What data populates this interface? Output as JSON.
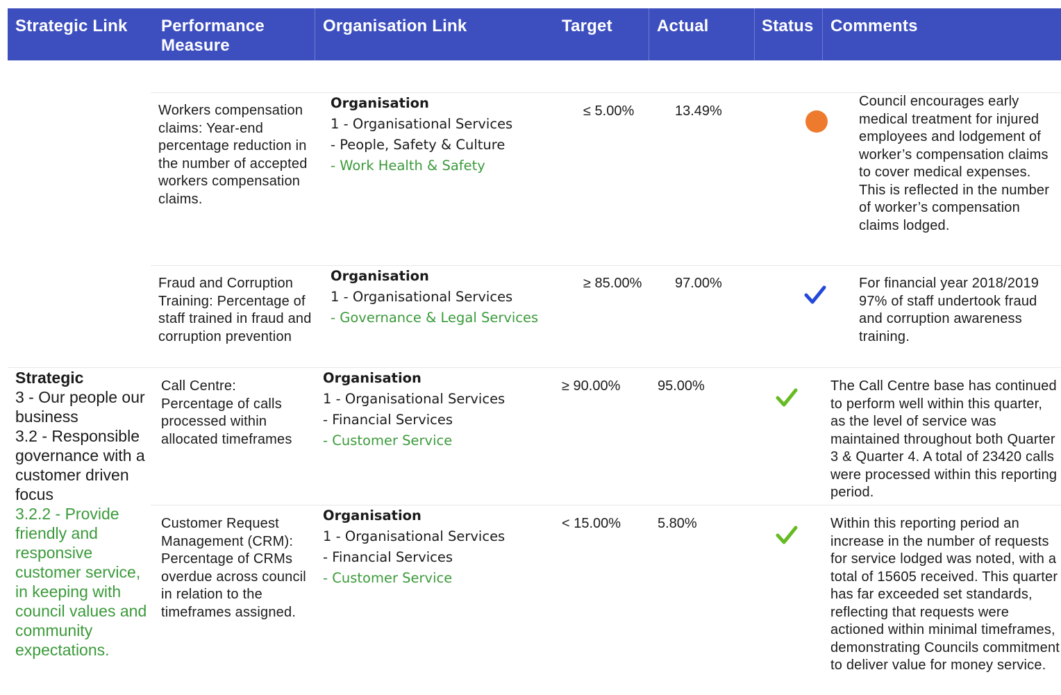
{
  "header": {
    "strategic_link": "Strategic Link",
    "performance_measure": "Performance Measure",
    "organisation_link": "Organisation Link",
    "target": "Target",
    "actual": "Actual",
    "status": "Status",
    "comments": "Comments",
    "color": "#3d4fbf"
  },
  "strategic": {
    "title": "Strategic",
    "line1": "3 - Our people our business",
    "line2": "3.2 - Responsible governance with a customer driven focus",
    "line3": "3.2.2 - Provide friendly and responsive customer service, in keeping with council values and community expectations."
  },
  "rows": [
    {
      "measure": "Workers compensation claims: Year-end percentage reduction in the number of accepted workers compensation claims.",
      "org_title": "Organisation",
      "org_line1": "1 - Organisational Services",
      "org_line2": "- People, Safety & Culture",
      "org_line3": "- Work Health & Safety",
      "target": "≤ 5.00%",
      "actual": "13.49%",
      "status": "orange-dot-icon",
      "comment": "Council encourages early medical treatment for injured employees and lodgement of worker’s compensation claims to cover medical expenses.  This is reflected in the number of worker’s compensation claims lodged."
    },
    {
      "measure": "Fraud and Corruption Training: Percentage of staff trained in fraud and corruption prevention",
      "org_title": "Organisation",
      "org_line1": "1 - Organisational Services",
      "org_line2": "- Governance & Legal Services",
      "target": "≥ 85.00%",
      "actual": "97.00%",
      "status": "blue-check-icon",
      "comment": "For financial year 2018/2019 97% of staff undertook fraud and corruption awareness training."
    },
    {
      "measure": "Call Centre: Percentage of calls processed within allocated timeframes",
      "org_title": "Organisation",
      "org_line1": "1 - Organisational Services",
      "org_line2": "- Financial Services",
      "org_line3": "- Customer Service",
      "target": "≥ 90.00%",
      "actual": "95.00%",
      "status": "green-check-icon",
      "comment": "The Call Centre base has continued to perform well within this quarter, as the level of service was maintained throughout both Quarter 3 & Quarter 4. A total of 23420 calls were processed within this reporting period."
    },
    {
      "measure": "Customer Request Management (CRM): Percentage of CRMs overdue across council in relation to the timeframes assigned.",
      "org_title": "Organisation",
      "org_line1": "1 - Organisational Services",
      "org_line2": "- Financial Services",
      "org_line3": "- Customer Service",
      "target": "< 15.00%",
      "actual": "5.80%",
      "status": "green-check-icon",
      "comment": "Within this reporting period an increase in the number of requests for service lodged was noted, with a total of 15605 received.  This quarter has far exceeded set standards, reflecting that requests were actioned within minimal timeframes, demonstrating Councils commitment to deliver value for money service."
    }
  ],
  "colors": {
    "green_text": "#3b9a3b",
    "orange_status": "#ee7a2d",
    "blue_check": "#2449d8",
    "green_check": "#66bb22"
  }
}
